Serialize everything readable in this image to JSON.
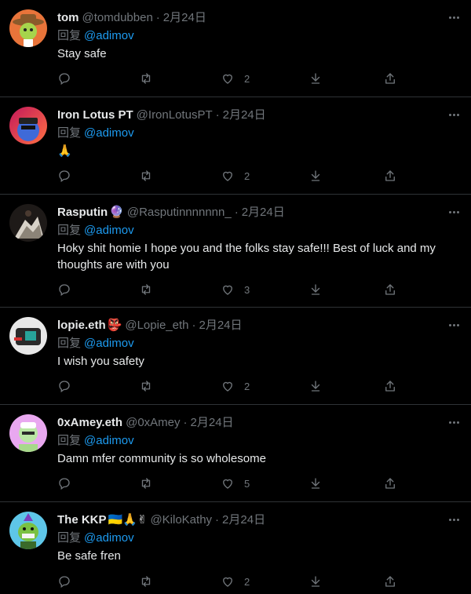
{
  "reply_label": "回复",
  "tweets": [
    {
      "name": "tom",
      "badges": "",
      "handle": "@tomdubben",
      "date": "2月24日",
      "mention": "@adimov",
      "text": "Stay safe",
      "likes": "2"
    },
    {
      "name": "Iron Lotus PT",
      "badges": "",
      "handle": "@IronLotusPT",
      "date": "2月24日",
      "mention": "@adimov",
      "text": "🙏",
      "likes": "2"
    },
    {
      "name": "Rasputin",
      "badges": "🔮",
      "handle": "@Rasputinnnnnnn_",
      "date": "2月24日",
      "mention": "@adimov",
      "text": "Hoky shit homie I hope you and the folks stay safe!!! Best of luck and my thoughts are with you",
      "likes": "3"
    },
    {
      "name": "lopie.eth",
      "badges": "👺",
      "handle": "@Lopie_eth",
      "date": "2月24日",
      "mention": "@adimov",
      "text": "I wish you safety",
      "likes": "2"
    },
    {
      "name": "0xAmey.eth",
      "badges": "",
      "handle": "@0xAmey",
      "date": "2月24日",
      "mention": "@adimov",
      "text": "Damn mfer community is so wholesome",
      "likes": "5"
    },
    {
      "name": "The KKP",
      "badges": "🇺🇦🙏✌",
      "handle": "@KiloKathy",
      "date": "2月24日",
      "mention": "@adimov",
      "text": "Be safe fren",
      "likes": "2"
    }
  ],
  "colors": {
    "background": "#000000",
    "text": "#e7e9ea",
    "muted": "#71767b",
    "link": "#1d9bf0",
    "border": "#2f3336"
  }
}
